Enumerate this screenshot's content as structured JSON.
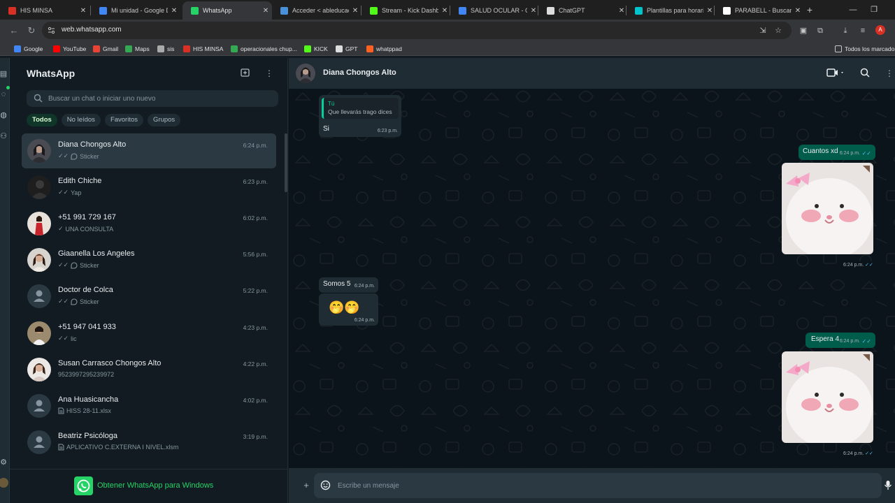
{
  "browser": {
    "tabs": [
      {
        "title": "HIS MINSA",
        "color": "#d93025",
        "active": false
      },
      {
        "title": "Mi unidad - Google Drive",
        "color": "#4285f4",
        "active": false
      },
      {
        "title": "WhatsApp",
        "color": "#25d366",
        "active": true
      },
      {
        "title": "Acceder < ableducación",
        "color": "#4a90d9",
        "active": false
      },
      {
        "title": "Stream - Kick Dashboard",
        "color": "#53fc18",
        "active": false
      },
      {
        "title": "SALUD OCULAR - Google",
        "color": "#4285f4",
        "active": false
      },
      {
        "title": "ChatGPT",
        "color": "#dddddd",
        "active": false
      },
      {
        "title": "Plantillas para horarios",
        "color": "#00c4cc",
        "active": false
      },
      {
        "title": "PARABELL - Buscar con",
        "color": "#ffffff",
        "active": false
      }
    ],
    "url": "web.whatsapp.com",
    "profile_initial": "A",
    "bookmarks": [
      {
        "label": "Google",
        "color": "#4285f4"
      },
      {
        "label": "YouTube",
        "color": "#ff0000"
      },
      {
        "label": "Gmail",
        "color": "#ea4335"
      },
      {
        "label": "Maps",
        "color": "#34a853"
      },
      {
        "label": "sis",
        "color": "#aaaaaa"
      },
      {
        "label": "HIS MINSA",
        "color": "#d93025"
      },
      {
        "label": "operacionales chup...",
        "color": "#34a853"
      },
      {
        "label": "KICK",
        "color": "#53fc18"
      },
      {
        "label": "GPT",
        "color": "#dddddd"
      },
      {
        "label": "whatppad",
        "color": "#ff6122"
      }
    ],
    "all_bookmarks": "Todos los marcadores"
  },
  "sidebar": {
    "title": "WhatsApp",
    "search_placeholder": "Buscar un chat o iniciar uno nuevo",
    "filters": [
      {
        "label": "Todos",
        "active": true
      },
      {
        "label": "No leídos",
        "active": false
      },
      {
        "label": "Favoritos",
        "active": false
      },
      {
        "label": "Grupos",
        "active": false
      }
    ],
    "chats": [
      {
        "name": "Diana Chongos Alto",
        "time": "6:24 p.m.",
        "preview": "Sticker",
        "mark": "✓✓",
        "type": "sticker",
        "avatar": "photo1",
        "selected": true
      },
      {
        "name": "Edith Chiche",
        "time": "6:23 p.m.",
        "preview": "Yap",
        "mark": "✓✓",
        "type": "text",
        "avatar": "photo2",
        "selected": false
      },
      {
        "name": "+51 991 729 167",
        "time": "6:02 p.m.",
        "preview": "UNA CONSULTA",
        "mark": "✓",
        "type": "text",
        "avatar": "photo3",
        "selected": false
      },
      {
        "name": "Giaanella Los Angeles",
        "time": "5:56 p.m.",
        "preview": "Sticker",
        "mark": "✓✓",
        "type": "sticker",
        "avatar": "photo4",
        "selected": false
      },
      {
        "name": "Doctor de Colca",
        "time": "5:22 p.m.",
        "preview": "Sticker",
        "mark": "✓✓",
        "type": "sticker",
        "avatar": "default",
        "selected": false
      },
      {
        "name": "+51 947 041 933",
        "time": "4:23 p.m.",
        "preview": "lic",
        "mark": "✓✓",
        "type": "text",
        "avatar": "photo5",
        "selected": false
      },
      {
        "name": "Susan Carrasco Chongos Alto",
        "time": "4:22 p.m.",
        "preview": "9523997295239972",
        "mark": "",
        "type": "text",
        "avatar": "photo6",
        "selected": false
      },
      {
        "name": "Ana Huasicancha",
        "time": "4:02 p.m.",
        "preview": "HISS 28-11.xlsx",
        "mark": "",
        "type": "doc",
        "avatar": "default",
        "selected": false
      },
      {
        "name": "Beatriz Psicóloga",
        "time": "3:19 p.m.",
        "preview": "APLICATIVO C.EXTERNA I NIVEL.xlsm",
        "mark": "",
        "type": "doc",
        "avatar": "default",
        "selected": false
      }
    ],
    "get_app": "Obtener WhatsApp para Windows"
  },
  "chat": {
    "contact_name": "Diana Chongos Alto",
    "messages": {
      "quoted_reply": {
        "author": "Tú",
        "quoted": "Que llevarás trago dices",
        "text": "Si",
        "time": "6:23 p.m."
      },
      "out1": {
        "text": "Cuantos xd",
        "time": "6:24 p.m."
      },
      "sticker1_time": "6:24 p.m.",
      "in2": {
        "text": "Somos 5",
        "time": "6:24 p.m."
      },
      "in3": {
        "text": "🤭🤭",
        "time": "6:24 p.m."
      },
      "out2": {
        "text": "Espera 4",
        "time": "6:24 p.m."
      },
      "sticker2_time": "6:24 p.m."
    },
    "composer_placeholder": "Escribe un mensaje"
  },
  "colors": {
    "accent": "#25d366",
    "outgoing_bubble": "#005c4b",
    "incoming_bubble": "#202c33",
    "read_tick": "#53bdeb"
  }
}
